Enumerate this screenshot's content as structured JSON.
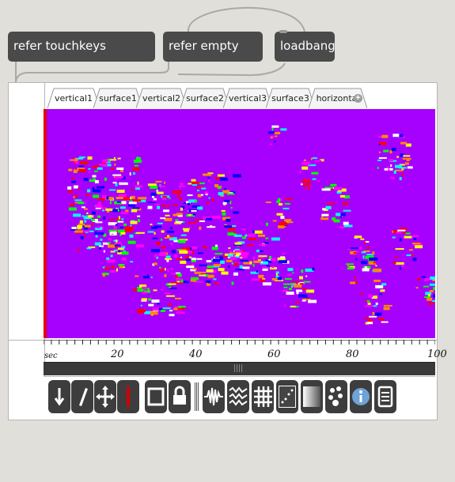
{
  "patcher": {
    "objects": [
      {
        "id": "refer-touchkeys",
        "label": "refer touchkeys"
      },
      {
        "id": "refer-empty",
        "label": "refer empty"
      },
      {
        "id": "loadbang",
        "label": "loadbang"
      }
    ]
  },
  "tabs": [
    {
      "label": "vertical1",
      "active": true
    },
    {
      "label": "surface1",
      "active": false
    },
    {
      "label": "vertical2",
      "active": false
    },
    {
      "label": "surface2",
      "active": false
    },
    {
      "label": "vertical3",
      "active": false
    },
    {
      "label": "surface3",
      "active": false
    },
    {
      "label": "horizontal",
      "active": false
    }
  ],
  "add_tab_icon": "plus-circle-icon",
  "view": {
    "background_color": "#a600ff",
    "playhead_color": "#e80000",
    "time_unit": "sec",
    "time_ticks": [
      20,
      40,
      60,
      80,
      100
    ],
    "time_range": [
      0,
      100
    ]
  },
  "toolbar": {
    "tools": [
      {
        "name": "pointer-tool",
        "icon": "arrow-down-icon",
        "active": false
      },
      {
        "name": "pencil-tool",
        "icon": "pencil-icon",
        "active": false
      },
      {
        "name": "move-tool",
        "icon": "move-arrows-icon",
        "active": false
      },
      {
        "name": "playhead-tool",
        "icon": "red-bar-icon",
        "active": false
      },
      {
        "name": "frame-tool",
        "icon": "square-icon",
        "active": false
      },
      {
        "name": "lock-tool",
        "icon": "lock-icon",
        "active": false
      },
      {
        "name": "waveform-tool",
        "icon": "waveform-icon",
        "active": false
      },
      {
        "name": "wave-stack-tool",
        "icon": "wave-stack-icon",
        "active": false
      },
      {
        "name": "grid-tool",
        "icon": "grid-icon",
        "active": false
      },
      {
        "name": "scatter-tool",
        "icon": "scatter-icon",
        "active": false
      },
      {
        "name": "gradient-tool",
        "icon": "gradient-icon",
        "active": false
      },
      {
        "name": "paws-tool",
        "icon": "paws-icon",
        "active": false
      },
      {
        "name": "info-tool",
        "icon": "info-icon",
        "active": true
      },
      {
        "name": "list-tool",
        "icon": "list-icon",
        "active": false
      }
    ]
  },
  "colors": {
    "palette": [
      "#ff0000",
      "#00ff00",
      "#ffff00",
      "#00ffff",
      "#0000ff",
      "#ff00ff",
      "#ff8800",
      "#ffffff"
    ]
  }
}
